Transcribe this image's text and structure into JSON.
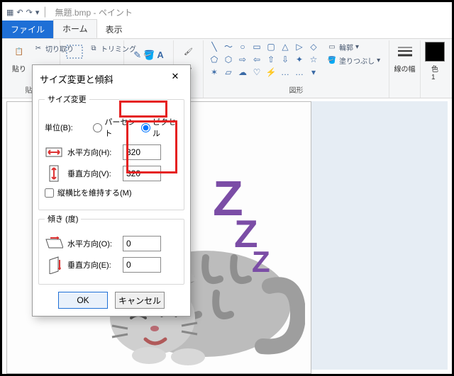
{
  "titlebar": {
    "document": "無題.bmp",
    "app": "ペイント",
    "sep": " - "
  },
  "tabs": {
    "file": "ファイル",
    "home": "ホーム",
    "view": "表示"
  },
  "ribbon": {
    "clipboard": {
      "paste": "貼り",
      "cut": "切り取り"
    },
    "image": {
      "select": "",
      "trim": "トリミング"
    },
    "brush": {
      "label": "ブラシ"
    },
    "shapes": {
      "label": "図形",
      "outline": "輪郭",
      "fill": "塗りつぶし"
    },
    "linewidth": {
      "label": "線の幅"
    },
    "color": {
      "label": "色",
      "index": "1"
    }
  },
  "dialog": {
    "title": "サイズ変更と傾斜",
    "resize": {
      "legend": "サイズ変更",
      "unit_label": "単位(B):",
      "percent": "パーセント",
      "pixel": "ピクセル",
      "h_label": "水平方向(H):",
      "h_value": "320",
      "v_label": "垂直方向(V):",
      "v_value": "320",
      "aspect": "縦横比を維持する(M)"
    },
    "skew": {
      "legend": "傾き (度)",
      "h_label": "水平方向(O):",
      "h_value": "0",
      "v_label": "垂直方向(E):",
      "v_value": "0"
    },
    "ok": "OK",
    "cancel": "キャンセル"
  }
}
